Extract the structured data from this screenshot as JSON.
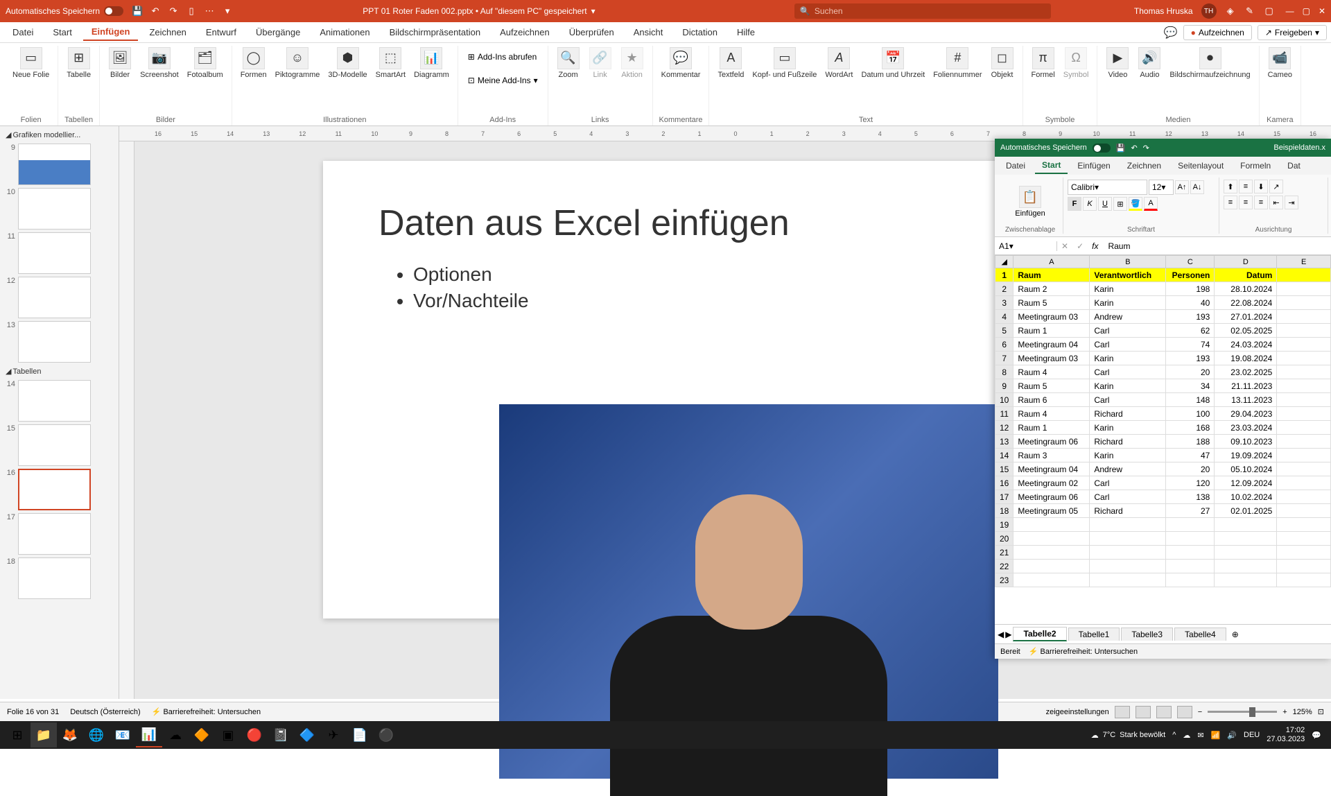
{
  "powerpoint": {
    "autosave_label": "Automatisches Speichern",
    "doc_title": "PPT 01 Roter Faden 002.pptx • Auf \"diesem PC\" gespeichert",
    "search_placeholder": "Suchen",
    "user_name": "Thomas Hruska",
    "user_initials": "TH",
    "tabs": [
      "Datei",
      "Start",
      "Einfügen",
      "Zeichnen",
      "Entwurf",
      "Übergänge",
      "Animationen",
      "Bildschirmpräsentation",
      "Aufzeichnen",
      "Überprüfen",
      "Ansicht",
      "Dictation",
      "Hilfe"
    ],
    "active_tab_index": 2,
    "record_btn": "Aufzeichnen",
    "share_btn": "Freigeben",
    "ribbon_groups": {
      "folien": {
        "label": "Folien",
        "new_slide": "Neue Folie"
      },
      "tabellen": {
        "label": "Tabellen",
        "table": "Tabelle"
      },
      "bilder": {
        "label": "Bilder",
        "pictures": "Bilder",
        "screenshot": "Screenshot",
        "album": "Fotoalbum"
      },
      "illustrationen": {
        "label": "Illustrationen",
        "shapes": "Formen",
        "icons": "Piktogramme",
        "models3d": "3D-Modelle",
        "smartart": "SmartArt",
        "chart": "Diagramm"
      },
      "addins": {
        "label": "Add-Ins",
        "get": "Add-Ins abrufen",
        "my": "Meine Add-Ins"
      },
      "links": {
        "label": "Links",
        "zoom": "Zoom",
        "link": "Link",
        "action": "Aktion"
      },
      "kommentare": {
        "label": "Kommentare",
        "comment": "Kommentar"
      },
      "text": {
        "label": "Text",
        "textbox": "Textfeld",
        "header": "Kopf- und Fußzeile",
        "wordart": "WordArt",
        "datetime": "Datum und Uhrzeit",
        "slidenum": "Foliennummer",
        "object": "Objekt"
      },
      "symbole": {
        "label": "Symbole",
        "formula": "Formel",
        "symbol": "Symbol"
      },
      "medien": {
        "label": "Medien",
        "video": "Video",
        "audio": "Audio",
        "screenrec": "Bildschirmaufzeichnung"
      },
      "kamera": {
        "label": "Kamera",
        "cameo": "Cameo"
      }
    },
    "thumbs": {
      "section1": "Grafiken modellier...",
      "section2": "Tabellen",
      "numbers": [
        "9",
        "10",
        "11",
        "12",
        "13",
        "14",
        "15",
        "16",
        "17",
        "18"
      ]
    },
    "slide": {
      "title": "Daten aus Excel einfügen",
      "bullets": [
        "Optionen",
        "Vor/Nachteile"
      ]
    },
    "status": {
      "slide_info": "Folie 16 von 31",
      "language": "Deutsch (Österreich)",
      "accessibility": "Barrierefreiheit: Untersuchen",
      "display_settings": "zeigeeinstellungen",
      "zoom": "125%"
    }
  },
  "excel": {
    "autosave_label": "Automatisches Speichern",
    "filename": "Beispieldaten.x",
    "tabs": [
      "Datei",
      "Start",
      "Einfügen",
      "Zeichnen",
      "Seitenlayout",
      "Formeln",
      "Dat"
    ],
    "active_tab_index": 1,
    "ribbon": {
      "clipboard": "Zwischenablage",
      "paste": "Einfügen",
      "font_group": "Schriftart",
      "font_name": "Calibri",
      "font_size": "12",
      "align_group": "Ausrichtung"
    },
    "name_box": "A1",
    "formula_value": "Raum",
    "headers": [
      "Raum",
      "Verantwortlich",
      "Personen",
      "Datum"
    ],
    "columns": [
      "A",
      "B",
      "C",
      "D",
      "E"
    ],
    "rows": [
      [
        "Raum 2",
        "Karin",
        "198",
        "28.10.2024"
      ],
      [
        "Raum 5",
        "Karin",
        "40",
        "22.08.2024"
      ],
      [
        "Meetingraum 03",
        "Andrew",
        "193",
        "27.01.2024"
      ],
      [
        "Raum 1",
        "Carl",
        "62",
        "02.05.2025"
      ],
      [
        "Meetingraum 04",
        "Carl",
        "74",
        "24.03.2024"
      ],
      [
        "Meetingraum 03",
        "Karin",
        "193",
        "19.08.2024"
      ],
      [
        "Raum 4",
        "Carl",
        "20",
        "23.02.2025"
      ],
      [
        "Raum 5",
        "Karin",
        "34",
        "21.11.2023"
      ],
      [
        "Raum 6",
        "Carl",
        "148",
        "13.11.2023"
      ],
      [
        "Raum 4",
        "Richard",
        "100",
        "29.04.2023"
      ],
      [
        "Raum 1",
        "Karin",
        "168",
        "23.03.2024"
      ],
      [
        "Meetingraum 06",
        "Richard",
        "188",
        "09.10.2023"
      ],
      [
        "Raum 3",
        "Karin",
        "47",
        "19.09.2024"
      ],
      [
        "Meetingraum 04",
        "Andrew",
        "20",
        "05.10.2024"
      ],
      [
        "Meetingraum 02",
        "Carl",
        "120",
        "12.09.2024"
      ],
      [
        "Meetingraum 06",
        "Carl",
        "138",
        "10.02.2024"
      ],
      [
        "Meetingraum 05",
        "Richard",
        "27",
        "02.01.2025"
      ]
    ],
    "sheet_tabs": [
      "Tabelle2",
      "Tabelle1",
      "Tabelle3",
      "Tabelle4"
    ],
    "active_sheet": 0,
    "status_ready": "Bereit",
    "status_access": "Barrierefreiheit: Untersuchen"
  },
  "taskbar": {
    "weather_temp": "7°C",
    "weather_desc": "Stark bewölkt",
    "lang": "DEU",
    "time": "17:02",
    "date": "27.03.2023"
  }
}
